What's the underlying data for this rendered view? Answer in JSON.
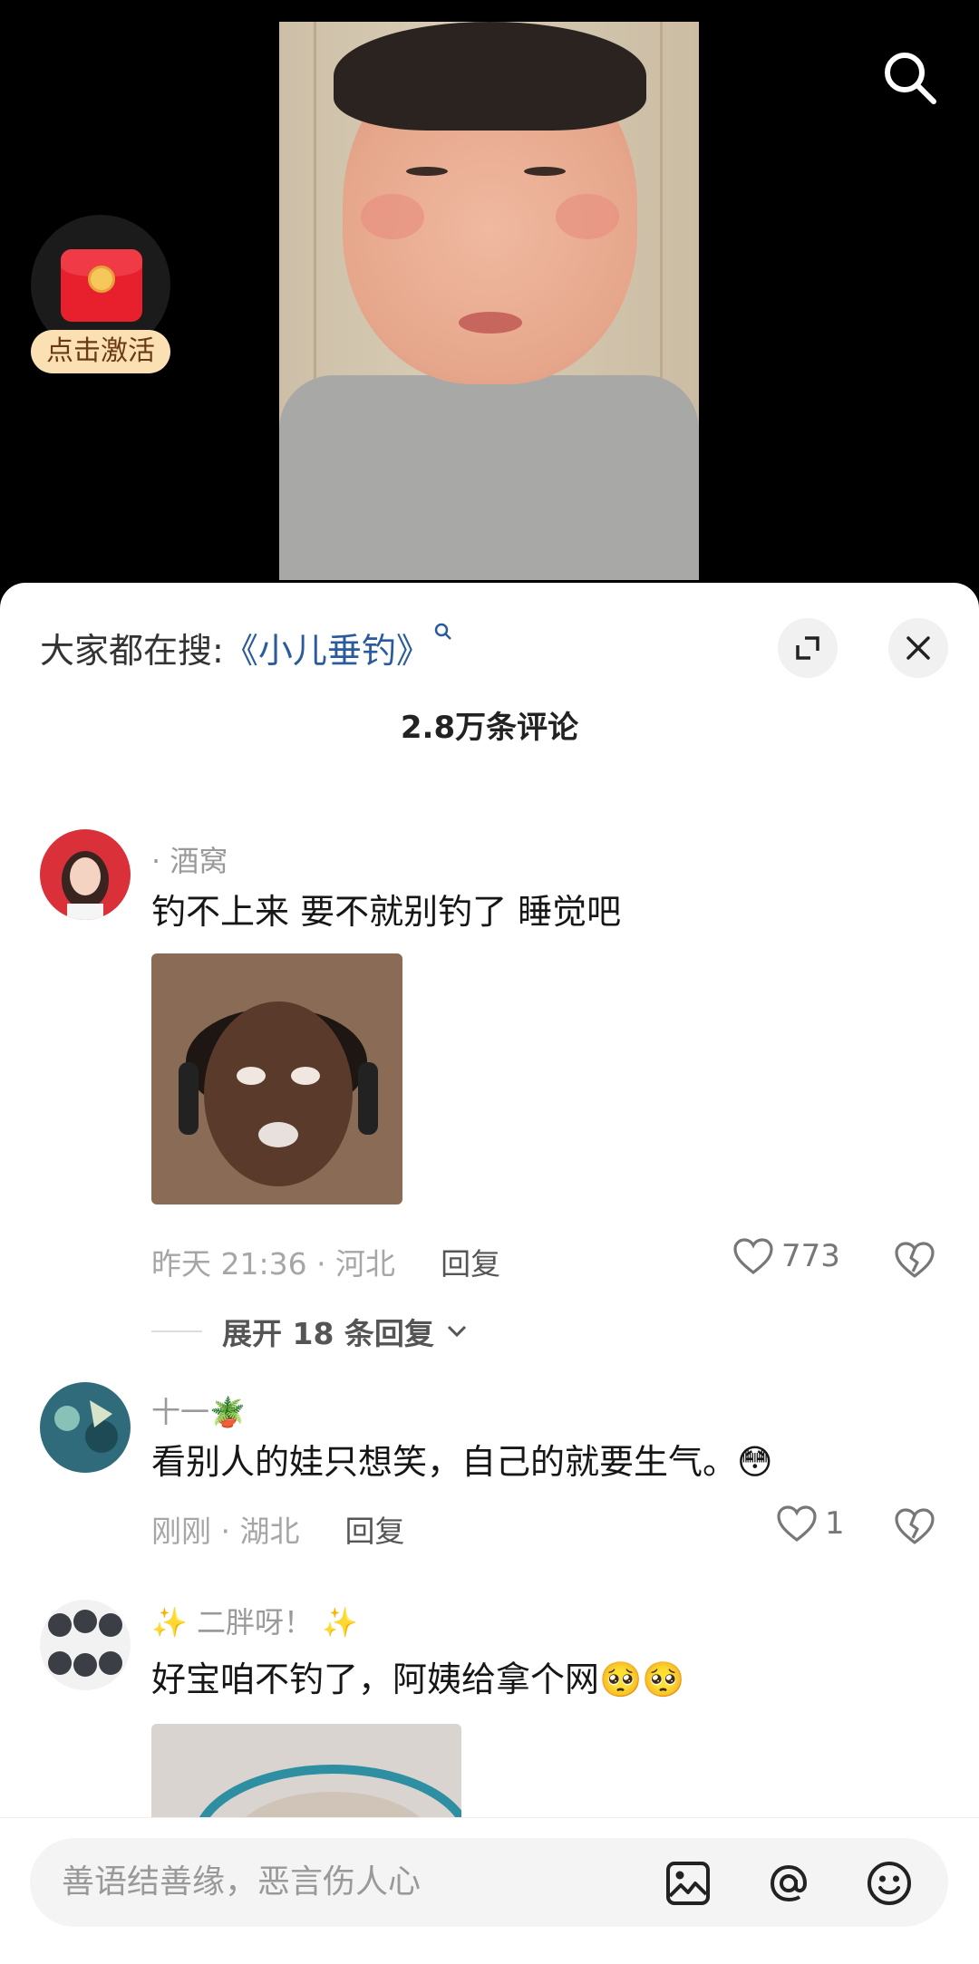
{
  "activity": {
    "label": "点击激活"
  },
  "header": {
    "hot_search_prefix": "大家都在搜:",
    "hot_search_keyword": "《小儿垂钓》",
    "comment_count": "2.8万条评论"
  },
  "comments": [
    {
      "name": "· 酒窝",
      "text": "钓不上来 要不就别钓了 睡觉吧",
      "time_loc": "昨天 21:36 · 河北",
      "reply_label": "回复",
      "likes": "773",
      "expand": "展开 18 条回复"
    },
    {
      "name": "十一🪴",
      "text": "看别人的娃只想笑，自己的就要生气。😳",
      "time_loc": "刚刚 · 湖北",
      "reply_label": "回复",
      "likes": "1"
    },
    {
      "name": "✨ 二胖呀！ ✨",
      "text": "好宝咱不钓了，阿姨给拿个网🥺🥺"
    }
  ],
  "input": {
    "placeholder": "善语结善缘，恶言伤人心"
  },
  "icons": {
    "search": "search-icon",
    "expand": "expand-icon",
    "close": "close-icon",
    "like": "heart-icon",
    "dislike": "broken-heart-icon",
    "image": "image-icon",
    "mention": "at-icon",
    "emoji": "emoji-icon"
  }
}
